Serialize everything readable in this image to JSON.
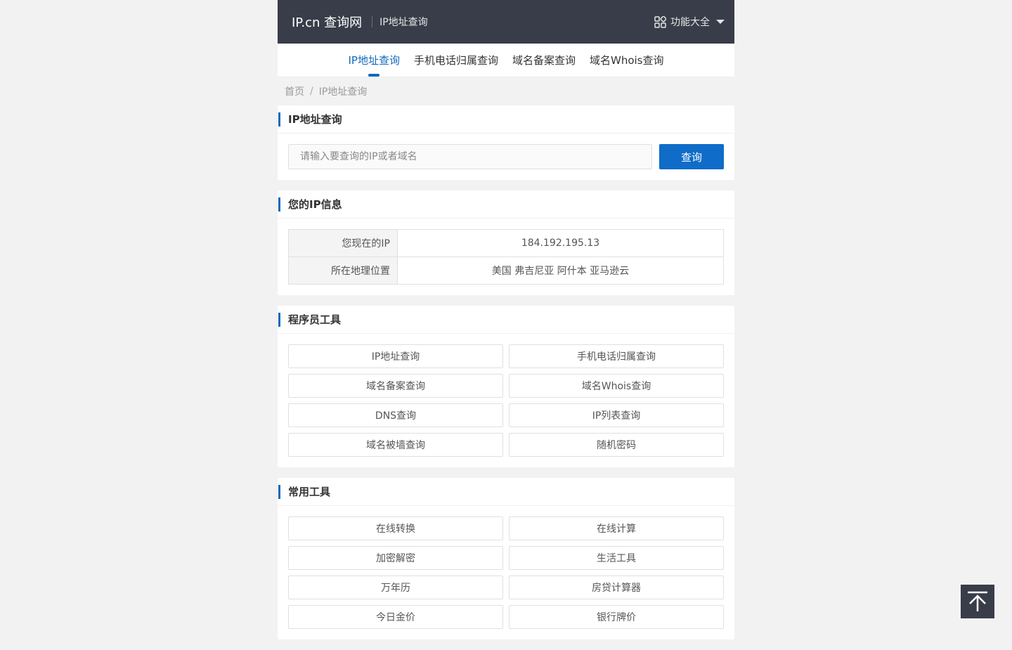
{
  "header": {
    "logo": "IP.cn 查询网",
    "subtitle": "IP地址查询",
    "menu_label": "功能大全"
  },
  "nav": {
    "tabs": [
      {
        "label": "IP地址查询",
        "active": true
      },
      {
        "label": "手机电话归属查询",
        "active": false
      },
      {
        "label": "域名备案查询",
        "active": false
      },
      {
        "label": "域名Whois查询",
        "active": false
      }
    ]
  },
  "breadcrumb": {
    "home": "首页",
    "separator": "/",
    "current": "IP地址查询"
  },
  "search": {
    "title": "IP地址查询",
    "placeholder": "请输入要查询的IP或者域名",
    "button": "查询"
  },
  "ipinfo": {
    "title": "您的IP信息",
    "rows": [
      {
        "key": "您现在的IP",
        "value": "184.192.195.13"
      },
      {
        "key": "所在地理位置",
        "value": "美国 弗吉尼亚 阿什本 亚马逊云"
      }
    ]
  },
  "dev_tools": {
    "title": "程序员工具",
    "items": [
      "IP地址查询",
      "手机电话归属查询",
      "域名备案查询",
      "域名Whois查询",
      "DNS查询",
      "IP列表查询",
      "域名被墙查询",
      "随机密码"
    ]
  },
  "common_tools": {
    "title": "常用工具",
    "items": [
      "在线转换",
      "在线计算",
      "加密解密",
      "生活工具",
      "万年历",
      "房贷计算器",
      "今日金价",
      "银行牌价"
    ]
  },
  "colors": {
    "accent": "#1169b9",
    "header_bg": "#393d49"
  }
}
